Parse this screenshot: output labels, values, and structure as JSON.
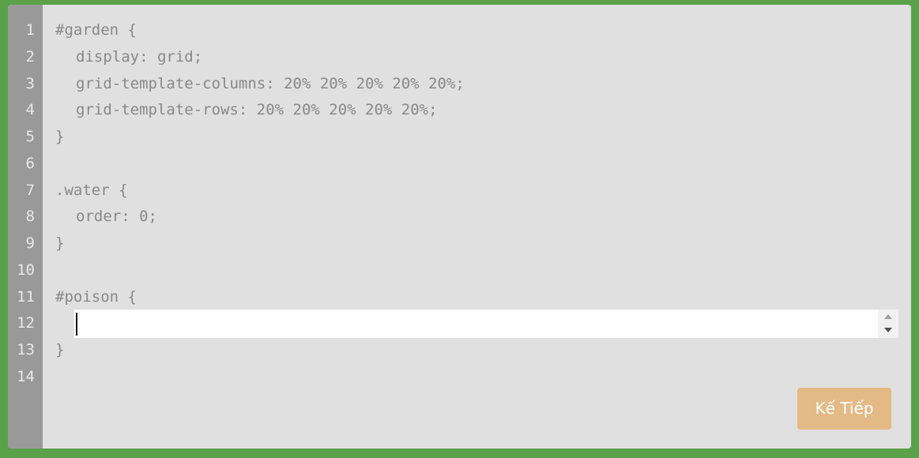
{
  "editor": {
    "line_numbers": [
      "1",
      "2",
      "3",
      "4",
      "5",
      "6",
      "7",
      "8",
      "9",
      "10",
      "11",
      "12",
      "13",
      "14"
    ],
    "lines": [
      "#garden {",
      "display: grid;",
      "grid-template-columns: 20% 20% 20% 20% 20%;",
      "grid-template-rows: 20% 20% 20% 20% 20%;",
      "}",
      "",
      ".water {",
      "order: 0;",
      "}",
      "",
      "#poison {",
      "",
      "}",
      ""
    ],
    "input_value": ""
  },
  "next_button_label": "Kế Tiếp",
  "colors": {
    "background": "#5aa14a",
    "editor": "#e0e0e0",
    "gutter": "#999999",
    "button": "#e3b985"
  }
}
